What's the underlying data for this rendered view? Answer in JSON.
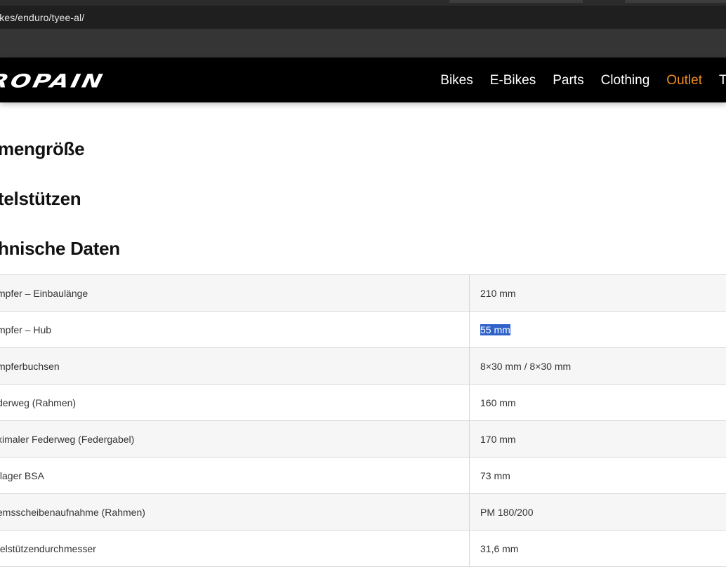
{
  "browser": {
    "url": "ikes/enduro/tyee-al/"
  },
  "nav": {
    "logo_text": "ROPAIN",
    "menu": [
      {
        "label": "Bikes"
      },
      {
        "label": "E-Bikes"
      },
      {
        "label": "Parts"
      },
      {
        "label": "Clothing"
      },
      {
        "label": "Outlet",
        "color": "#f08a1c"
      },
      {
        "label": "T"
      }
    ]
  },
  "sections": {
    "frame_size": "mengröße",
    "seatposts": "telstützen",
    "tech_data": "hnische Daten"
  },
  "specs": [
    {
      "label": "mpfer – Einbaulänge",
      "value": "210 mm"
    },
    {
      "label": "mpfer – Hub",
      "value": "55 mm",
      "selected": true
    },
    {
      "label": "mpferbuchsen",
      "value": "8×30 mm / 8×30 mm"
    },
    {
      "label": "derweg (Rahmen)",
      "value": "160 mm"
    },
    {
      "label": "ximaler Federweg (Federgabel)",
      "value": "170 mm"
    },
    {
      "label": "tlager BSA",
      "value": "73 mm"
    },
    {
      "label": "emsscheibenaufnahme (Rahmen)",
      "value": "PM 180/200"
    },
    {
      "label": "telstützendurchmesser",
      "value": "31,6 mm"
    }
  ],
  "colors": {
    "accent": "#f08a1c",
    "selection": "#2f62c9"
  }
}
